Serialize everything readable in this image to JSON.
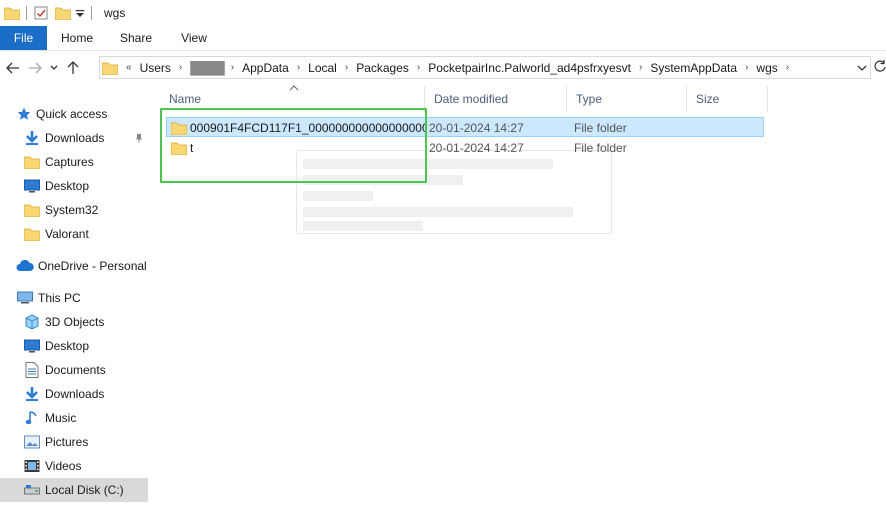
{
  "window": {
    "title": "wgs"
  },
  "ribbon": {
    "file": "File",
    "tabs": [
      "Home",
      "Share",
      "View"
    ]
  },
  "address": {
    "crumbs": [
      "Users",
      "█████",
      "AppData",
      "Local",
      "Packages",
      "PocketpairInc.Palworld_ad4psfrxyesvt",
      "SystemAppData",
      "wgs"
    ],
    "overflow": "«"
  },
  "sidebar": {
    "quick_access": "Quick access",
    "quick_items": [
      "Downloads",
      "Captures",
      "Desktop",
      "System32",
      "Valorant"
    ],
    "onedrive": "OneDrive - Personal",
    "this_pc": "This PC",
    "pc_items": [
      "3D Objects",
      "Desktop",
      "Documents",
      "Downloads",
      "Music",
      "Pictures",
      "Videos",
      "Local Disk (C:)"
    ]
  },
  "columns": {
    "name": "Name",
    "date": "Date modified",
    "type": "Type",
    "size": "Size"
  },
  "files": [
    {
      "name": "000901F4FCD117F1_000000000000000000...",
      "date": "20-01-2024 14:27",
      "type": "File folder"
    },
    {
      "name": "t",
      "date": "20-01-2024 14:27",
      "type": "File folder"
    }
  ],
  "colors": {
    "accent": "#1a6ec7",
    "selection": "#cce8ff",
    "highlight": "#4fc34f",
    "folder": "#f7d774"
  }
}
